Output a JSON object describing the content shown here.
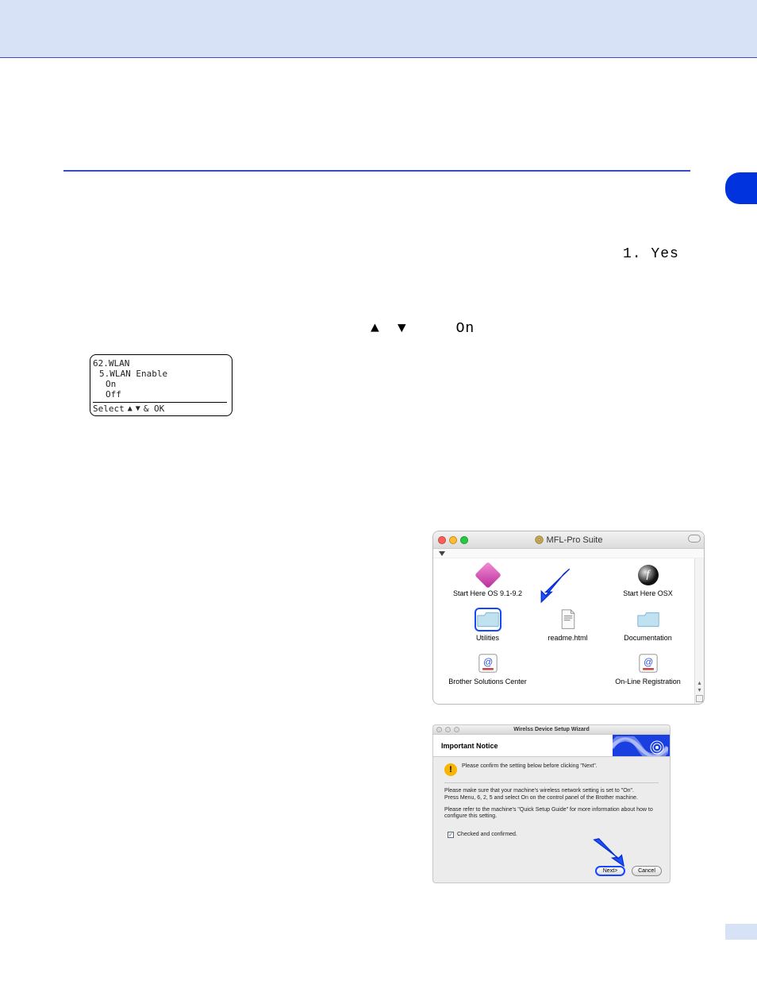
{
  "yes_label": "1. Yes",
  "arrow_up": "▲",
  "arrow_down": "▼",
  "on_label": "On",
  "lcd": {
    "l1": "62.WLAN",
    "l2": "5.WLAN Enable",
    "l3": "On",
    "l4": "Off",
    "select": "Select",
    "tail": "& OK"
  },
  "finder": {
    "title": "MFL-Pro Suite",
    "items": {
      "start91": "Start Here OS 9.1-9.2",
      "startosx": "Start Here OSX",
      "utilities": "Utilities",
      "readme": "readme.html",
      "documentation": "Documentation",
      "bsc": "Brother Solutions Center",
      "online_reg": "On-Line Registration"
    }
  },
  "wizard": {
    "title": "Wirelss Device Setup Wizard",
    "heading": "Important Notice",
    "line1": "Please confirm the setting below before clicking \"Next\".",
    "line2a": "Please make sure that your machine's wireless network setting is set to \"On\".",
    "line2b": "Press Menu, 6, 2, 5 and select On on the control panel of the Brother machine.",
    "line3": "Please refer to the machine's \"Quick Setup Guide\" for more information about how to configure this setting.",
    "checkbox": "Checked and confirmed.",
    "next": "Next>",
    "cancel": "Cancel"
  }
}
